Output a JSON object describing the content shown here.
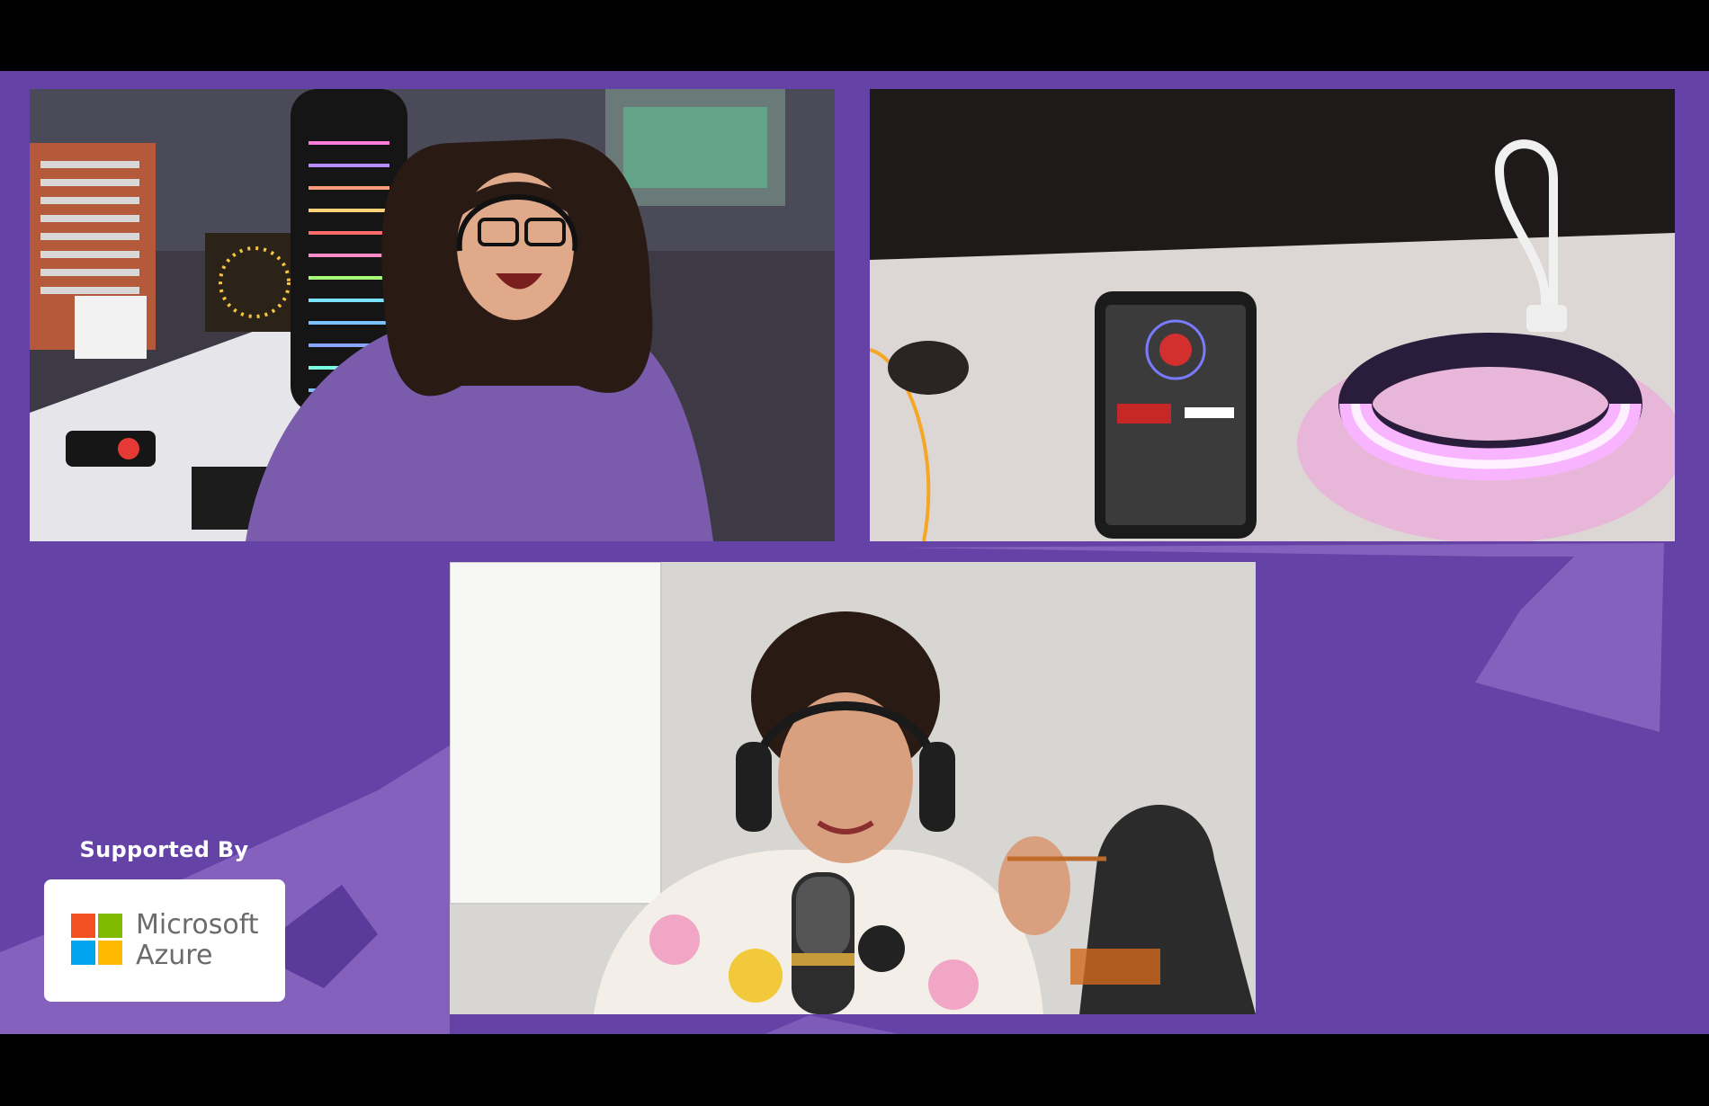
{
  "stream": {
    "sponsor_heading": "Supported By",
    "sponsor": {
      "line1": "Microsoft",
      "line2": "Azure",
      "logo_colors": [
        "#f25022",
        "#7fba00",
        "#00a4ef",
        "#ffb900"
      ]
    }
  },
  "participants": [
    {
      "tile": "top-left",
      "description": "person with headset in a workshop with LED lights"
    },
    {
      "tile": "top-right",
      "description": "overhead camera showing a phone app and a glowing LED wristband"
    },
    {
      "tile": "bottom-center",
      "description": "person with headphones and a microphone"
    }
  ],
  "colors": {
    "background": "#6442a6",
    "accent_light": "#8d6cc4",
    "letterbox": "#000000"
  }
}
